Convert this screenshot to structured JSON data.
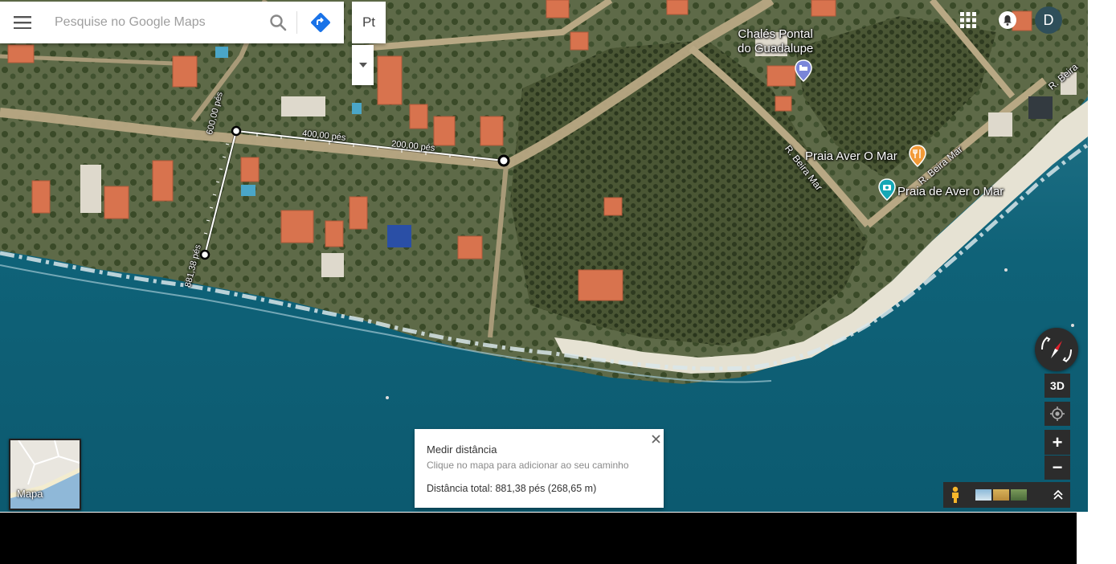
{
  "search": {
    "placeholder": "Pesquise no Google Maps"
  },
  "layer_button": {
    "label": "Pt"
  },
  "user": {
    "initial": "D"
  },
  "pois": {
    "chales": "Chalés Pontal\ndo Guadalupe",
    "restaurant": "Praia Aver O Mar",
    "beach": "Praia de Aver o Mar"
  },
  "roads": {
    "beira_mar_1": "R. Beira Mar",
    "beira_mar_2": "R. Beira Mar",
    "beira_mar_3": "R. Beira"
  },
  "measure_labels": {
    "seg1": "600,00 pés",
    "seg2": "400,00 pés",
    "seg3": "200,00 pés",
    "seg4": "881,38 pés"
  },
  "controls": {
    "three_d": "3D",
    "zoom_in": "+",
    "zoom_out": "−"
  },
  "minimap": {
    "label": "Mapa"
  },
  "measure_panel": {
    "title": "Medir distância",
    "subtitle": "Clique no mapa para adicionar ao seu caminho",
    "total": "Distância total: 881,38 pés (268,65 m)"
  },
  "colors": {
    "sea": "#10607a",
    "land": "#4d5a3a",
    "sand": "#e6e2d3",
    "panel_bg": "#ffffff",
    "controls_bg": "#2c2c2c",
    "directions_blue": "#1a73e8",
    "poi_orange": "#f29a38",
    "poi_teal": "#14a7b5",
    "poi_hotel": "#7a86d8"
  }
}
